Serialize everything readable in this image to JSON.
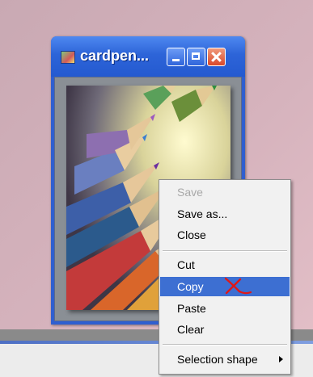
{
  "window": {
    "title": "cardpen...",
    "buttons": [
      "minimize",
      "maximize",
      "close"
    ]
  },
  "image": {
    "description_icon": "colored-pencils-picture"
  },
  "context_menu": {
    "items": [
      {
        "label": "Save",
        "enabled": false
      },
      {
        "label": "Save as...",
        "enabled": true
      },
      {
        "label": "Close",
        "enabled": true
      },
      {
        "label": "Cut",
        "enabled": true
      },
      {
        "label": "Copy",
        "enabled": true,
        "selected": true
      },
      {
        "label": "Paste",
        "enabled": true
      },
      {
        "label": "Clear",
        "enabled": true
      },
      {
        "label": "Selection shape",
        "enabled": true,
        "submenu": true
      }
    ]
  },
  "colors": {
    "title_bar": "#245ad0",
    "selection": "#3d6fd2",
    "annotation": "#e01818"
  }
}
